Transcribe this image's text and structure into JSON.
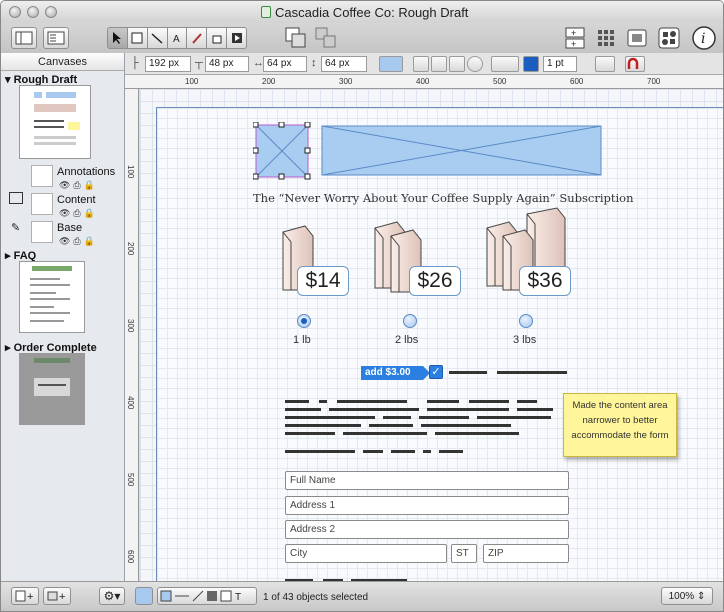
{
  "window": {
    "title": "Cascadia Coffee Co: Rough Draft"
  },
  "inspector": {
    "x": "192 px",
    "y": "48 px",
    "width": "64 px",
    "height": "64 px",
    "stroke_width": "1 pt"
  },
  "sidebar": {
    "header": "Canvases",
    "canvases": [
      {
        "name": "Rough Draft",
        "expanded": true
      },
      {
        "name": "FAQ",
        "expanded": true
      },
      {
        "name": "Order Complete",
        "expanded": true
      }
    ],
    "layers": [
      {
        "name": "Annotations"
      },
      {
        "name": "Content"
      },
      {
        "name": "Base"
      }
    ]
  },
  "ruler": {
    "h_ticks": [
      "100",
      "200",
      "300",
      "400",
      "500",
      "600",
      "700"
    ],
    "v_ticks": [
      "100",
      "200",
      "300",
      "400",
      "500",
      "600"
    ]
  },
  "mockup": {
    "headline": "The “Never Worry About Your Coffee Supply Again” Subscription",
    "options": [
      {
        "price": "$14",
        "label": "1 lb",
        "selected": true
      },
      {
        "price": "$26",
        "label": "2 lbs",
        "selected": false
      },
      {
        "price": "$36",
        "label": "3 lbs",
        "selected": false
      }
    ],
    "addon_label": "add $3.00",
    "fields": {
      "full_name": "Full Name",
      "address1": "Address 1",
      "address2": "Address 2",
      "city": "City",
      "state": "ST",
      "zip": "ZIP"
    }
  },
  "note": {
    "text": "Made the content area narrower to better accommodate the form"
  },
  "status": {
    "selection": "1 of 43 objects selected",
    "zoom": "100%"
  },
  "colors": {
    "accent": "#2a7fe0",
    "note_bg": "#fff59b",
    "selection": "#b85ad0"
  }
}
